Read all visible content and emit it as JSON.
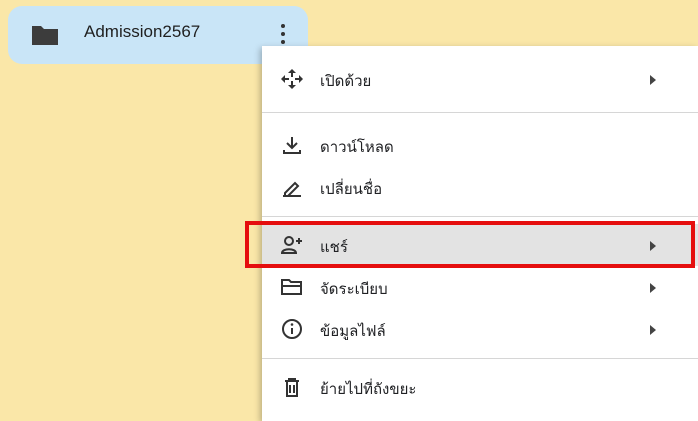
{
  "folder": {
    "name": "Admission2567",
    "icon": "folder-icon"
  },
  "menu": {
    "items": [
      {
        "label": "เปิดด้วย",
        "icon": "move-arrows-icon",
        "submenu": true
      },
      {
        "label": "ดาวน์โหลด",
        "icon": "download-icon",
        "submenu": false
      },
      {
        "label": "เปลี่ยนชื่อ",
        "icon": "rename-pen-icon",
        "submenu": false
      },
      {
        "label": "แชร์",
        "icon": "add-person-icon",
        "submenu": true,
        "highlighted": true
      },
      {
        "label": "จัดระเบียบ",
        "icon": "folder-open-icon",
        "submenu": true
      },
      {
        "label": "ข้อมูลไฟล์",
        "icon": "info-icon",
        "submenu": true
      },
      {
        "label": "ย้ายไปที่ถังขยะ",
        "icon": "trash-icon",
        "submenu": false
      }
    ]
  },
  "colors": {
    "background": "#fae7a8",
    "folder_chip": "#c9e5f7",
    "highlight": "#e3e3e3",
    "annotation": "#e50e0e"
  }
}
